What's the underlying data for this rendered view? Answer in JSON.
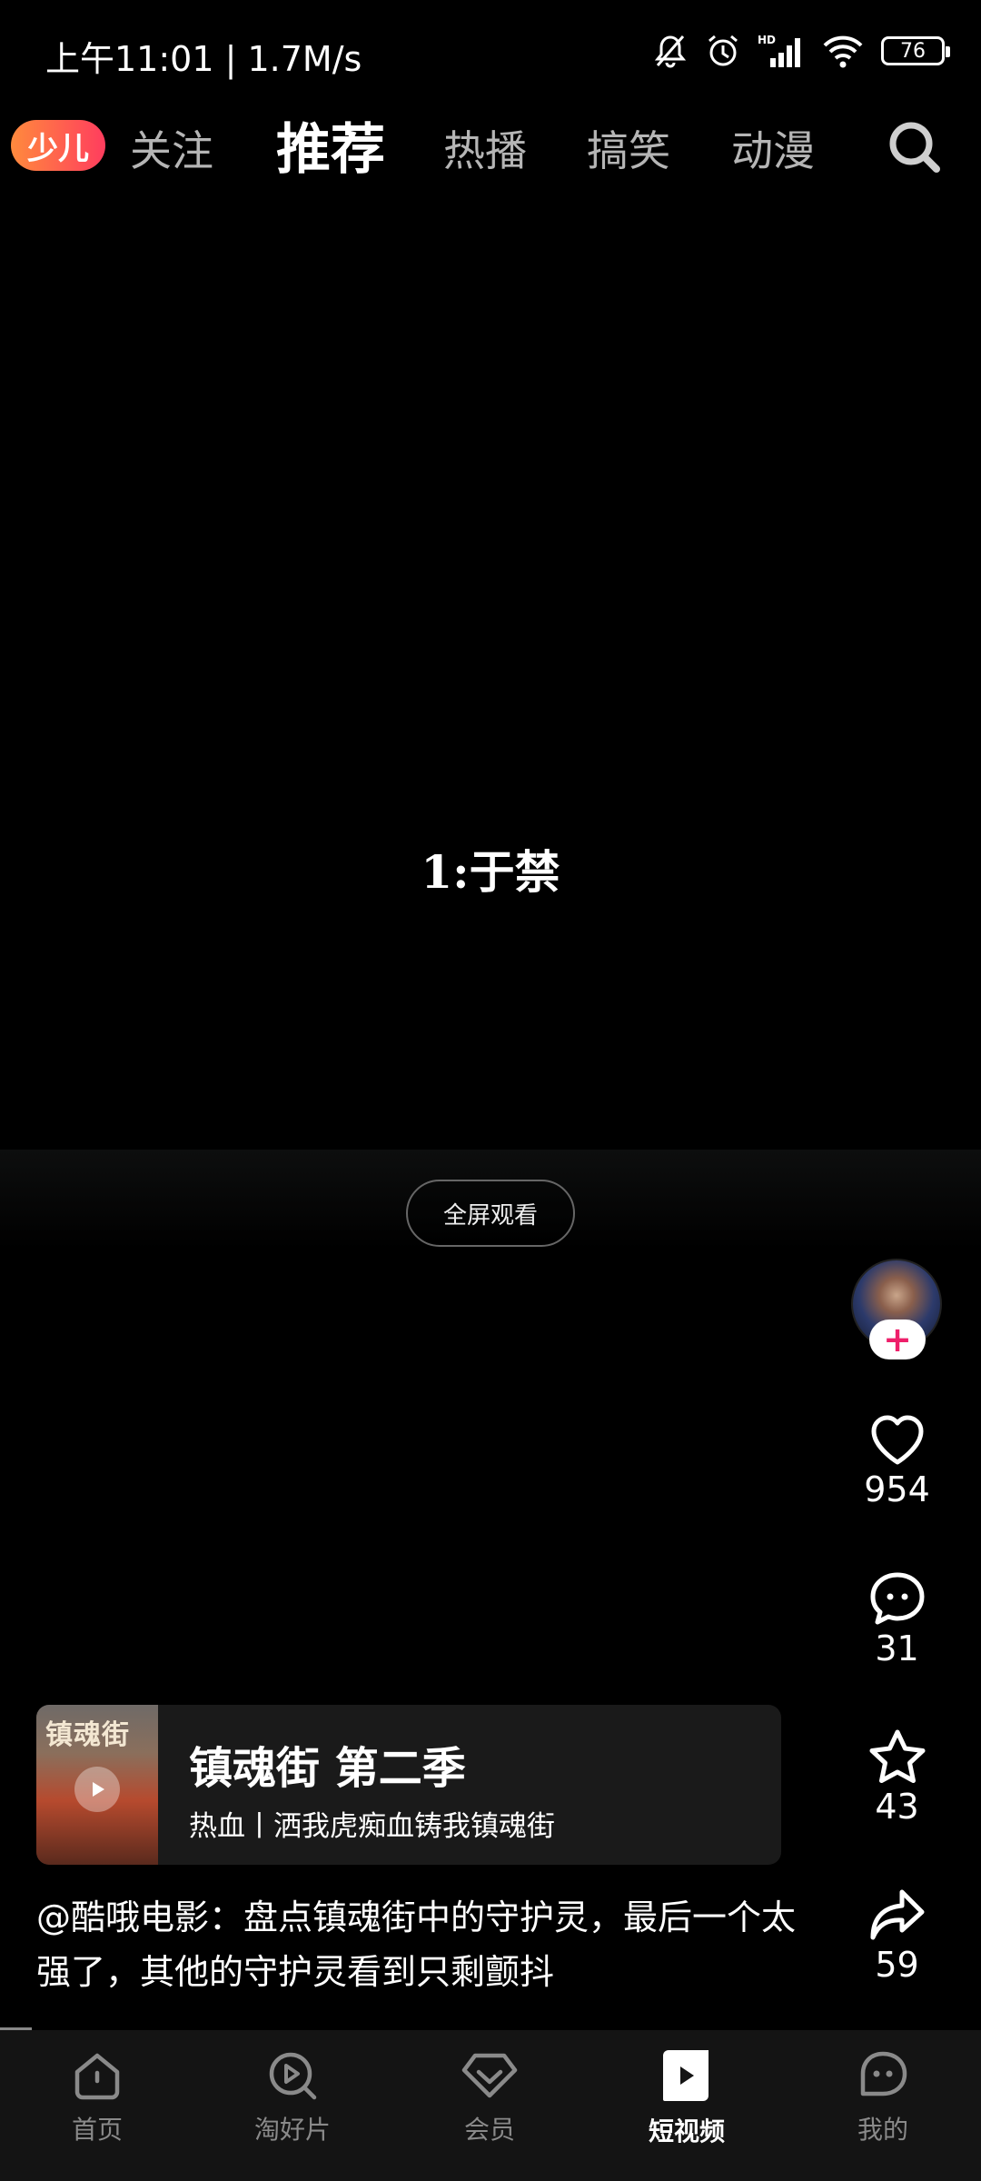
{
  "status_bar": {
    "time": "上午11:01 | 1.7M/s",
    "battery": "76",
    "icons": [
      "mute-bell-icon",
      "alarm-icon",
      "hd-signal-icon",
      "wifi-icon",
      "battery-icon"
    ]
  },
  "top_nav": {
    "kids_logo": "少儿",
    "tabs": [
      {
        "label": "关注",
        "active": false
      },
      {
        "label": "推荐",
        "active": true
      },
      {
        "label": "热播",
        "active": false
      },
      {
        "label": "搞笑",
        "active": false
      },
      {
        "label": "动漫",
        "active": false
      }
    ],
    "search_icon": "search-icon"
  },
  "video": {
    "caption": "1:于禁",
    "fullscreen_label": "全屏观看"
  },
  "actions": {
    "follow_label": "+",
    "likes": "954",
    "comments": "31",
    "favorites": "43",
    "shares": "59"
  },
  "series_card": {
    "thumb_title": "镇魂街",
    "title": "镇魂街 第二季",
    "subtitle": "热血丨洒我虎痴血铸我镇魂街"
  },
  "description": "@酷哦电影：盘点镇魂街中的守护灵，最后一个太强了，其他的守护灵看到只剩颤抖",
  "bottom_nav": [
    {
      "label": "首页",
      "icon": "home-icon",
      "active": false
    },
    {
      "label": "淘好片",
      "icon": "discover-icon",
      "active": false
    },
    {
      "label": "会员",
      "icon": "vip-icon",
      "active": false
    },
    {
      "label": "短视频",
      "icon": "short-video-icon",
      "active": true
    },
    {
      "label": "我的",
      "icon": "profile-icon",
      "active": false
    }
  ],
  "colors": {
    "background": "#000000",
    "accent_pink": "#ee1f6a",
    "inactive_text": "#8a8a8a",
    "nav_bg": "#141414"
  }
}
